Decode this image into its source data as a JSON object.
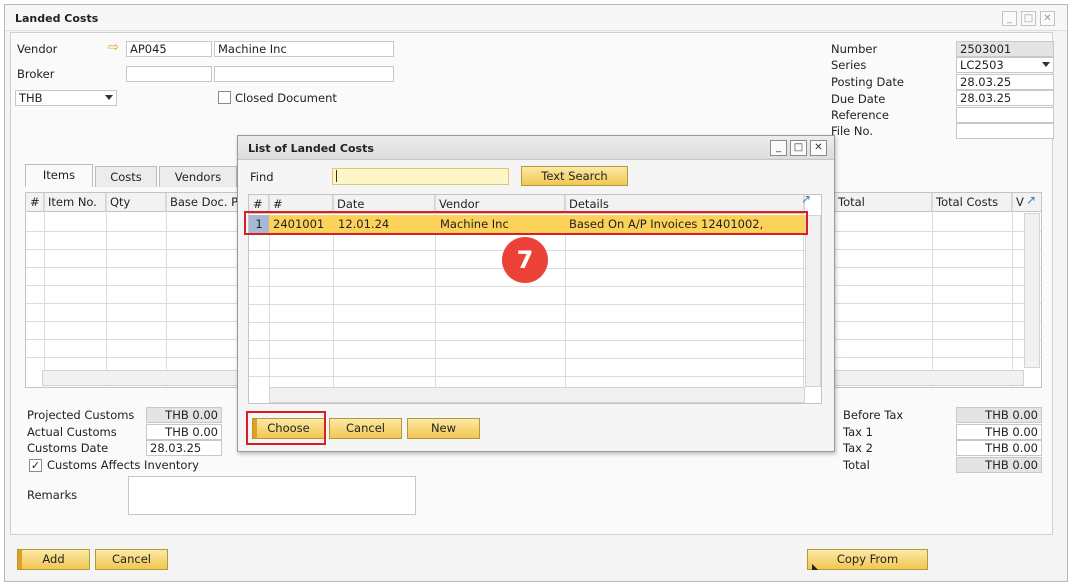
{
  "window": {
    "title": "Landed Costs"
  },
  "header": {
    "vendor_label": "Vendor",
    "vendor_code": "AP045",
    "vendor_name": "Machine Inc",
    "broker_label": "Broker",
    "currency": "THB",
    "closed_doc_label": "Closed Document",
    "number_label": "Number",
    "number_value": "2503001",
    "series_label": "Series",
    "series_value": "LC2503",
    "posting_label": "Posting Date",
    "posting_value": "28.03.25",
    "due_label": "Due Date",
    "due_value": "28.03.25",
    "reference_label": "Reference",
    "fileno_label": "File No."
  },
  "tabs": [
    "Items",
    "Costs",
    "Vendors"
  ],
  "items_grid": {
    "columns": [
      "#",
      "Item No.",
      "Qty",
      "Base Doc. Pr"
    ],
    "right_columns": [
      "Total",
      "Total Costs",
      "V"
    ]
  },
  "customs": {
    "projected_label": "Projected Customs",
    "projected_value": "THB 0.00",
    "actual_label": "Actual Customs",
    "actual_value": "THB 0.00",
    "date_label": "Customs Date",
    "date_value": "28.03.25",
    "affects_label": "Customs Affects Inventory",
    "remarks_label": "Remarks"
  },
  "totals": {
    "before_tax_label": "Before Tax",
    "before_tax_value": "THB 0.00",
    "tax1_label": "Tax 1",
    "tax1_value": "THB 0.00",
    "tax2_label": "Tax 2",
    "tax2_value": "THB 0.00",
    "total_label": "Total",
    "total_value": "THB 0.00"
  },
  "footer": {
    "add": "Add",
    "cancel": "Cancel",
    "copy_from": "Copy From"
  },
  "dialog": {
    "title": "List of Landed Costs",
    "find_label": "Find",
    "text_search": "Text Search",
    "columns": [
      "#",
      "#",
      "Date",
      "Vendor",
      "Details"
    ],
    "rows": [
      {
        "idx": "1",
        "num": "2401001",
        "date": "12.01.24",
        "vendor": "Machine Inc",
        "details": "Based On A/P Invoices 12401002,"
      }
    ],
    "choose": "Choose",
    "cancel": "Cancel",
    "new": "New"
  },
  "badge": "7",
  "colors": {
    "highlight": "#d81f26",
    "badge": "#ec4137",
    "button": "#f1c751",
    "selected_row": "#fcd25a"
  }
}
